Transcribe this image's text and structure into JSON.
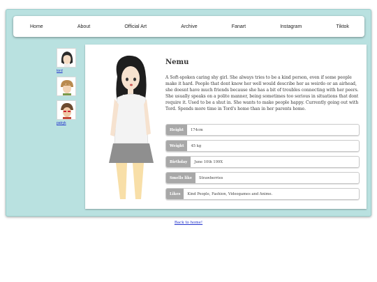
{
  "nav": {
    "items": [
      "Home",
      "About",
      "Official Art",
      "Archive",
      "Fanart",
      "Instagram",
      "Tiktok"
    ]
  },
  "sidebar": {
    "characters": [
      {
        "label": "tord",
        "hair_color": "#2a2a2a"
      },
      {
        "label": "",
        "hair_color": "#b98a4e"
      },
      {
        "label": "patryk",
        "hair_color": "#6b4a2f"
      }
    ]
  },
  "profile": {
    "name": "Nemu",
    "description": "A Soft-spoken caring shy girl. She always tries to be a kind person, even if some people make it hard. People that dont know her well would describe her as weirdo or an airhead, she doesnt have much friends because she has a bit of troubles connecting with her peers. She usually speaks on a polite manner, being sometimes too serious in situations that dont require it. Used to be a shut in. She wants to make people happy. Currently going out with Tord. Spends more time in Tord's home than in her parents home.",
    "stats": [
      {
        "key": "Height",
        "value": "174cm"
      },
      {
        "key": "Weight",
        "value": "45 kg"
      },
      {
        "key": "Birthday",
        "value": "June 10th 199X"
      },
      {
        "key": "Smells like",
        "value": "Strawberries"
      },
      {
        "key": "Likes",
        "value": "Kind People, Fashion, Videogames and Anime."
      }
    ]
  },
  "footer": {
    "back_link": "Back to home!"
  },
  "colors": {
    "frame_bg": "#b9e1e0",
    "stat_key_bg": "#a8a8a8",
    "link": "#2233cc"
  }
}
